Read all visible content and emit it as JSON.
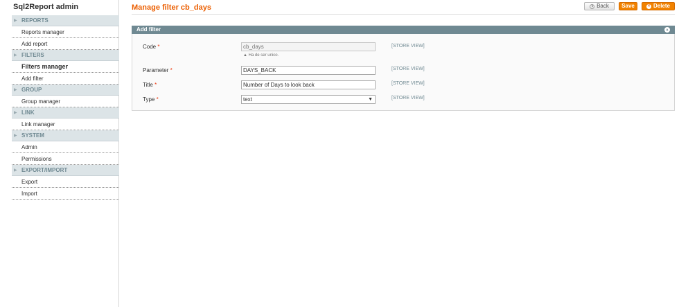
{
  "sidebar": {
    "title": "Sql2Report admin",
    "sections": [
      {
        "label": "REPORTS",
        "items": [
          {
            "label": "Reports manager"
          },
          {
            "label": "Add report"
          }
        ]
      },
      {
        "label": "FILTERS",
        "items": [
          {
            "label": "Filters manager",
            "active": true
          },
          {
            "label": "Add filter"
          }
        ]
      },
      {
        "label": "GROUP",
        "items": [
          {
            "label": "Group manager"
          }
        ]
      },
      {
        "label": "LINK",
        "items": [
          {
            "label": "Link manager"
          }
        ]
      },
      {
        "label": "SYSTEM",
        "items": [
          {
            "label": "Admin"
          },
          {
            "label": "Permissions"
          }
        ]
      },
      {
        "label": "EXPORT/IMPORT",
        "items": [
          {
            "label": "Export"
          },
          {
            "label": "Import"
          }
        ]
      }
    ]
  },
  "header": {
    "title": "Manage filter cb_days",
    "back_label": "Back",
    "save_label": "Save",
    "delete_label": "Delete"
  },
  "form": {
    "section_title": "Add filter",
    "code": {
      "label": "Code",
      "value": "cb_days",
      "note": "Ha de ser unico.",
      "scope": "[STORE VIEW]"
    },
    "parameter": {
      "label": "Parameter",
      "value": "DAYS_BACK",
      "scope": "[STORE VIEW]"
    },
    "title": {
      "label": "Title",
      "value": "Number of Days to look back",
      "scope": "[STORE VIEW]"
    },
    "type": {
      "label": "Type",
      "value": "text",
      "scope": "[STORE VIEW]"
    }
  },
  "colors": {
    "accent": "#eb5e00",
    "button": "#f18200",
    "section_header": "#6f8992"
  }
}
